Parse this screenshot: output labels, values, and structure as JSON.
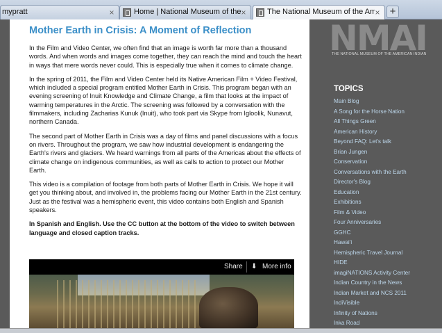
{
  "browser": {
    "tabs": [
      {
        "title": "mypratt",
        "active": false
      },
      {
        "title": "Home | National Museum of the Am...",
        "active": false
      },
      {
        "title": "The National Museum of the Americ...",
        "active": true
      }
    ],
    "new_tab_label": "+",
    "close_label": "×"
  },
  "article": {
    "title": "Mother Earth in Crisis: A Moment of Reflection",
    "paragraphs": [
      "In the Film and Video Center, we often find that an image is worth far more than a thousand words. And when words and images come together, they can reach the mind and touch the heart in ways that mere words never could. This is especially true when it comes to climate change.",
      "In the spring of 2011, the Film and Video Center held its Native American Film + Video Festival, which included a special program entitled Mother Earth in Crisis. This program began with an evening screening of Inuit Knowledge and Climate Change, a film that looks at the impact of warming temperatures in the Arctic. The screening was followed by a conversation with the filmmakers, including Zacharias Kunuk (Inuit), who took part via Skype from Igloolik, Nunavut, northern Canada.",
      "The second part of Mother Earth in Crisis was a day of films and panel discussions with a focus on rivers. Throughout the program, we saw how industrial development is endangering the Earth's rivers and glaciers. We heard warnings from all parts of the Americas about the effects of climate change on indigenous communities, as well as calls to action to protect our Mother Earth.",
      "This video is a compilation of footage from both parts of Mother Earth in Crisis. We hope it will get you thinking about, and involved in, the problems facing our Mother Earth in the 21st century. Just as the festival was a hemispheric event, this video contains both English and Spanish speakers.",
      "In Spanish and English. Use the CC button at the bottom of the video to switch between language and closed caption tracks."
    ],
    "video": {
      "share_label": "Share",
      "more_info_label": "More info"
    }
  },
  "sidebar": {
    "logo_text": "NMAI",
    "logo_subtitle": "THE NATIONAL MUSEUM OF THE AMERICAN INDIAN",
    "topics_heading": "TOPICS",
    "topics": [
      "Main Blog",
      "A Song for the Horse Nation",
      "All Things Green",
      "American History",
      "Beyond FAQ: Let's talk",
      "Brian Jungen",
      "Conservation",
      "Conversations with the Earth",
      "Director's Blog",
      "Education",
      "Exhibitions",
      "Film & Video",
      "Four Anniversaries",
      "GGHC",
      "Hawai'i",
      "Hemispheric Travel Journal",
      "HIDE",
      "imagiNATIONS Activity Center",
      "Indian Country in the News",
      "Indian Market and NCS 2011",
      "IndiVisible",
      "Infinity of Nations",
      "Inka Road"
    ]
  },
  "colors": {
    "title_blue": "#3b8fc8",
    "sidebar_bg": "#5a5a5a",
    "topic_link": "#bcd6ea"
  }
}
